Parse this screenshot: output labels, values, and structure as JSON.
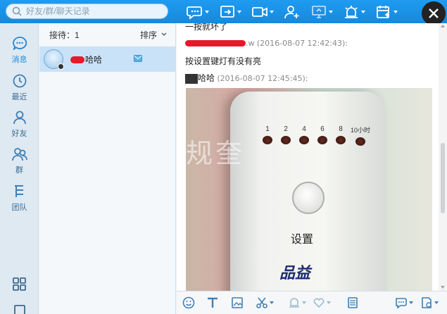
{
  "search": {
    "placeholder": "好友/群/聊天记录"
  },
  "toolbar": {
    "icons": [
      "chat-bubble-icon",
      "share-screen-icon",
      "video-call-icon",
      "add-contact-icon",
      "remote-desktop-icon",
      "alarm-icon",
      "calendar-icon"
    ]
  },
  "nav": {
    "items": [
      {
        "label": "消息",
        "icon": "message-icon",
        "active": true
      },
      {
        "label": "最近",
        "icon": "clock-icon"
      },
      {
        "label": "好友",
        "icon": "person-icon"
      },
      {
        "label": "群",
        "icon": "group-icon"
      },
      {
        "label": "团队",
        "icon": "team-icon"
      }
    ],
    "bottom_icons": [
      "apps-grid-icon",
      "device-icon"
    ]
  },
  "contacts": {
    "reception_label": "接待：1",
    "sort_label": "排序",
    "rows": [
      {
        "name_suffix": "哈哈"
      }
    ]
  },
  "chat": {
    "line1_text": "一按就坏了",
    "line2_name_suffix": ".w",
    "line2_time": "(2016-08-07 12:42:43):",
    "line3_text": "按设置键灯有没有亮",
    "line4_name_suffix": "哈哈",
    "line4_time": "(2016-08-07 12:45:45):",
    "photo": {
      "watermark": "规奎",
      "leds": [
        "1",
        "2",
        "4",
        "6",
        "8",
        "10小时"
      ],
      "button_label": "设置",
      "brand": "品益"
    }
  },
  "colors": {
    "topbar": "#1a8fe3",
    "nav_bg": "#dfe9f2",
    "selected_row": "#c9e2f7",
    "redact": "#e6192a",
    "icon_blue": "#3f7fb6"
  }
}
